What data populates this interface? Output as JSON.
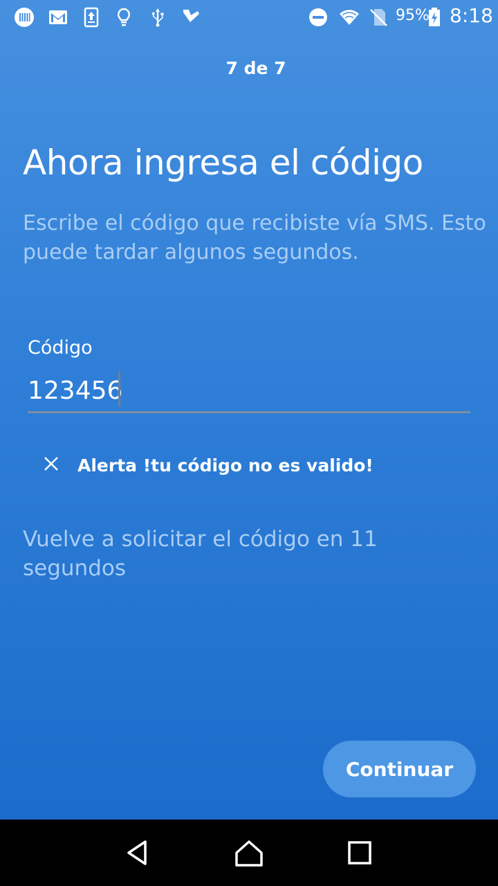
{
  "status_bar": {
    "icons": [
      "carrier-icon",
      "gmail-icon",
      "upload-icon",
      "lightbulb-icon",
      "usb-icon",
      "check-app-icon",
      "do-not-disturb-icon",
      "wifi-icon",
      "no-sim-icon",
      "battery-icon"
    ],
    "battery": "95%",
    "time": "8:18"
  },
  "header": {
    "step": "7 de 7"
  },
  "main": {
    "title": "Ahora ingresa el código",
    "subtitle": "Escribe el código que recibiste vía SMS. Esto puede tardar algunos segundos.",
    "code_label": "Código",
    "code_value": "123456",
    "alert_text": "Alerta !tu código no es valido!",
    "resend_text": "Vuelve a solicitar el código en 11 segundos",
    "continue_label": "Continuar"
  },
  "colors": {
    "background_top": "#4690df",
    "background_bottom": "#1b6ccb",
    "secondary_text": "#a9cdf3",
    "button": "#4d97e5"
  },
  "nav_bar": {
    "icons": [
      "back-icon",
      "home-icon",
      "recents-icon"
    ]
  }
}
